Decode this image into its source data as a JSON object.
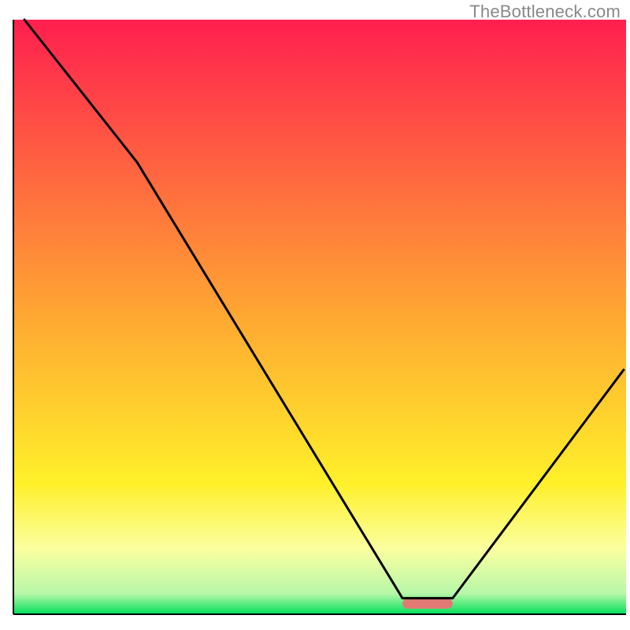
{
  "watermark": "TheBottleneck.com",
  "chart_data": {
    "type": "line",
    "title": "",
    "xlabel": "",
    "ylabel": "",
    "xlim": [
      0,
      100
    ],
    "ylim": [
      0,
      100
    ],
    "x": [
      1.8,
      20.2,
      63.5,
      71.7,
      99.6
    ],
    "values": [
      100,
      76.0,
      2.7,
      2.7,
      41.1
    ],
    "marker": {
      "x_start": 63.5,
      "x_end": 71.7,
      "y": 1.8,
      "color": "#e17a74"
    },
    "background_gradient": {
      "type": "vertical",
      "stops": [
        {
          "offset": 0.0,
          "color": "#ff1f4f"
        },
        {
          "offset": 0.5,
          "color": "#ffa832"
        },
        {
          "offset": 0.78,
          "color": "#fff02a"
        },
        {
          "offset": 0.89,
          "color": "#fbffa0"
        },
        {
          "offset": 0.965,
          "color": "#b7f7a8"
        },
        {
          "offset": 1.0,
          "color": "#00e05a"
        }
      ]
    },
    "axes": {
      "color": "#000000",
      "width": 2
    }
  }
}
